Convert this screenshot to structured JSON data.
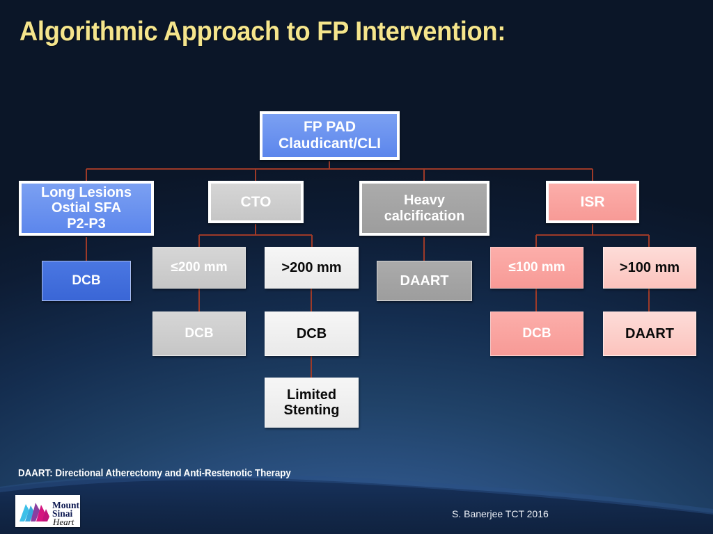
{
  "slide": {
    "title": "Algorithmic Approach to FP Intervention:",
    "footnote": "DAART: Directional Atherectomy and Anti-Restenotic Therapy",
    "credit": "S. Banerjee TCT 2016",
    "title_color": "#f5e58c",
    "background_color": "#0d1729"
  },
  "logo": {
    "line1": "Mount",
    "line2": "Sinai",
    "line3": "Heart"
  },
  "chart_data": {
    "type": "diagram",
    "title": "Algorithmic Approach to FP Intervention:",
    "diagram_kind": "decision-tree-flowchart",
    "root": "FP PAD\nClaudicant/CLI",
    "branches": [
      {
        "condition": "Long Lesions\nOstial SFA\nP2-P3",
        "color": "#6b93ef",
        "children": [
          {
            "label": "DCB",
            "color": "#4272dd"
          }
        ]
      },
      {
        "condition": "CTO",
        "color": "#cecece",
        "children": [
          {
            "label": "≤200 mm",
            "color": "#cfcfcf",
            "children": [
              {
                "label": "DCB",
                "color": "#d4d4d4"
              }
            ]
          },
          {
            "label": ">200 mm",
            "color": "#efefef",
            "children": [
              {
                "label": "DCB",
                "color": "#f2f2f2",
                "children": [
                  {
                    "label": "Limited\nStenting",
                    "color": "#f4f4f4"
                  }
                ]
              }
            ]
          }
        ]
      },
      {
        "condition": "Heavy\ncalcification",
        "color": "#a4a4a4",
        "children": [
          {
            "label": "DAART",
            "color": "#a4a4a4"
          }
        ]
      },
      {
        "condition": "ISR",
        "color": "#f9a4a0",
        "children": [
          {
            "label": "≤100 mm",
            "color": "#f9a4a0",
            "children": [
              {
                "label": "DCB",
                "color": "#f9a4a0"
              }
            ]
          },
          {
            "label": ">100 mm",
            "color": "#fccfca",
            "children": [
              {
                "label": "DAART",
                "color": "#fccfca"
              }
            ]
          }
        ]
      }
    ]
  },
  "nodes": {
    "root": {
      "label": "FP PAD\nClaudicant/CLI"
    },
    "long_lesions": {
      "label": "Long Lesions\nOstial SFA\nP2-P3"
    },
    "long_dcb": {
      "label": "DCB"
    },
    "cto": {
      "label": "CTO"
    },
    "cto_le200": {
      "label": "≤200 mm"
    },
    "cto_le200_dcb": {
      "label": "DCB"
    },
    "cto_gt200": {
      "label": ">200 mm"
    },
    "cto_gt200_dcb": {
      "label": "DCB"
    },
    "limited_stent": {
      "label": "Limited\nStenting"
    },
    "heavy_calc": {
      "label": "Heavy\ncalcification"
    },
    "heavy_daart": {
      "label": "DAART"
    },
    "isr": {
      "label": "ISR"
    },
    "isr_le100": {
      "label": "≤100 mm"
    },
    "isr_le100_dcb": {
      "label": "DCB"
    },
    "isr_gt100": {
      "label": ">100 mm"
    },
    "isr_gt100_daart": {
      "label": "DAART"
    }
  }
}
